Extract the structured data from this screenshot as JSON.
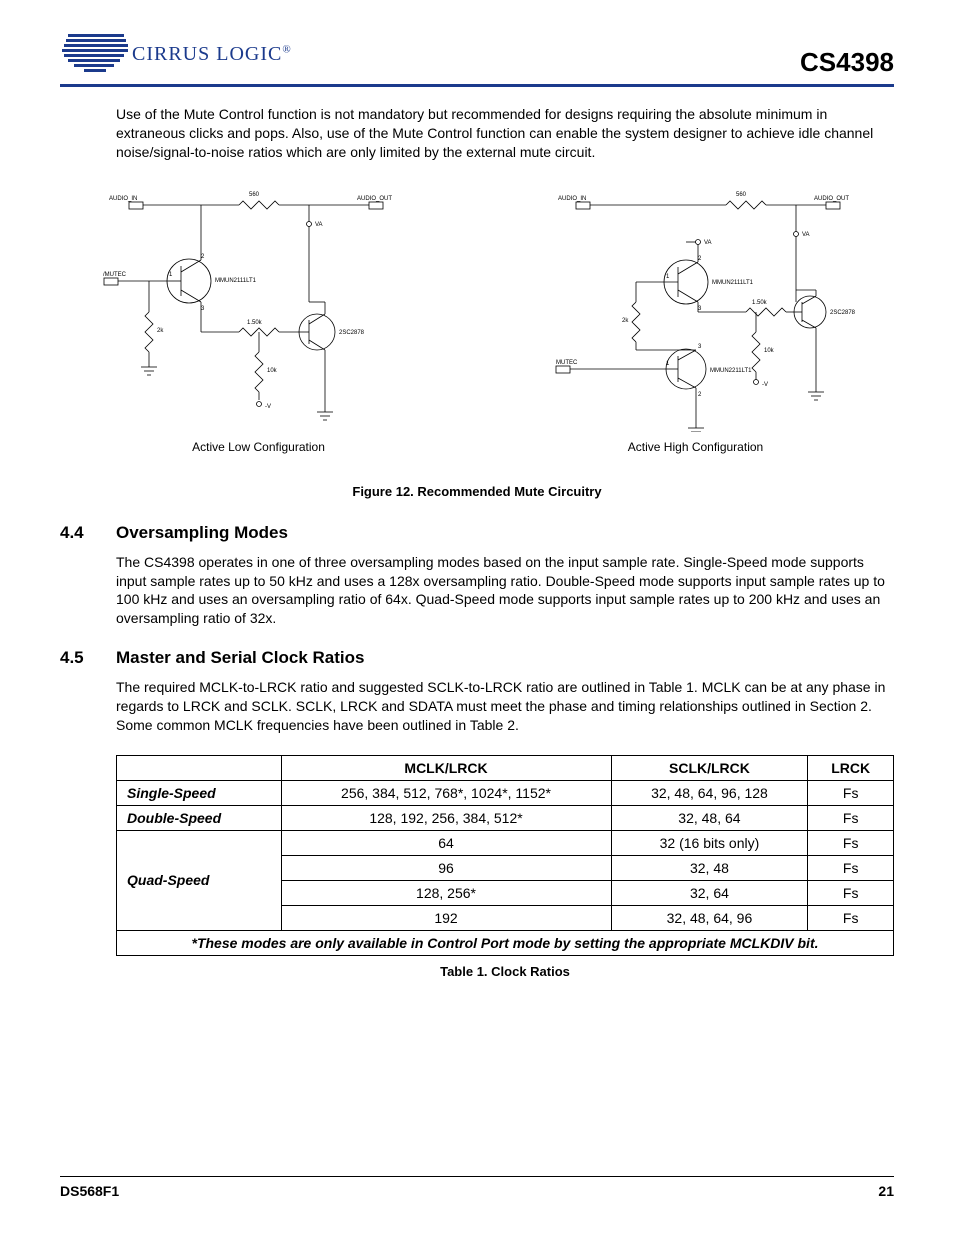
{
  "header": {
    "logo_text": "CIRRUS LOGIC",
    "logo_reg": "®",
    "part_number": "CS4398"
  },
  "intro_paragraph": "Use of the Mute Control function is not mandatory but recommended for designs requiring the absolute minimum in extraneous clicks and pops. Also, use of the Mute Control function can enable the system designer to achieve idle channel noise/signal-to-noise ratios which are only limited by the external mute circuit.",
  "circuits": {
    "left_caption": "Active Low Configuration",
    "right_caption": "Active High Configuration",
    "labels": {
      "audio_in": "AUDIO_IN",
      "audio_out": "AUDIO_OUT",
      "va": "VA",
      "mutec_low": "/MUTEC",
      "mutec_high": "MUTEC",
      "minus_v": "-V",
      "r560": "560",
      "r2k": "2k",
      "r10k": "10k",
      "r150k": "1.50k",
      "q1": "MMUN2111LT1",
      "q2": "2SC2878",
      "q3": "MMUN2211LT1"
    }
  },
  "figure12_caption": "Figure 12.  Recommended Mute Circuitry",
  "section_44": {
    "num": "4.4",
    "title": "Oversampling Modes",
    "text": "The CS4398 operates in one of three oversampling modes based on the input sample rate. Single-Speed mode supports input sample rates up to 50 kHz and uses a 128x oversampling ratio. Double-Speed mode supports input sample rates up to 100 kHz and uses an oversampling ratio of 64x. Quad-Speed mode supports input sample rates up to 200 kHz and uses an oversampling ratio of 32x."
  },
  "section_45": {
    "num": "4.5",
    "title": "Master and Serial Clock Ratios",
    "text": "The required MCLK-to-LRCK ratio and suggested SCLK-to-LRCK ratio are outlined in Table 1. MCLK can be at any phase in regards to LRCK and SCLK. SCLK, LRCK and SDATA must meet the phase and timing relationships outlined in Section 2. Some common MCLK frequencies have been outlined in Table 2."
  },
  "table1": {
    "headers": {
      "c0": "",
      "c1": "MCLK/LRCK",
      "c2": "SCLK/LRCK",
      "c3": "LRCK"
    },
    "rows": [
      {
        "label": "Single-Speed",
        "mclk": "256, 384, 512, 768*, 1024*, 1152*",
        "sclk": "32, 48, 64, 96, 128",
        "lrck": "Fs"
      },
      {
        "label": "Double-Speed",
        "mclk": "128, 192, 256, 384, 512*",
        "sclk": "32, 48, 64",
        "lrck": "Fs"
      },
      {
        "label": "Quad-Speed",
        "mclk": "64",
        "sclk": "32 (16 bits only)",
        "lrck": "Fs"
      },
      {
        "label": "",
        "mclk": "96",
        "sclk": "32, 48",
        "lrck": "Fs"
      },
      {
        "label": "",
        "mclk": "128, 256*",
        "sclk": "32, 64",
        "lrck": "Fs"
      },
      {
        "label": "",
        "mclk": "192",
        "sclk": "32, 48, 64, 96",
        "lrck": "Fs"
      }
    ],
    "footnote": "*These modes are only available in Control Port mode by setting the appropriate MCLKDIV bit.",
    "caption": "Table 1. Clock Ratios"
  },
  "footer": {
    "doc": "DS568F1",
    "page": "21"
  }
}
